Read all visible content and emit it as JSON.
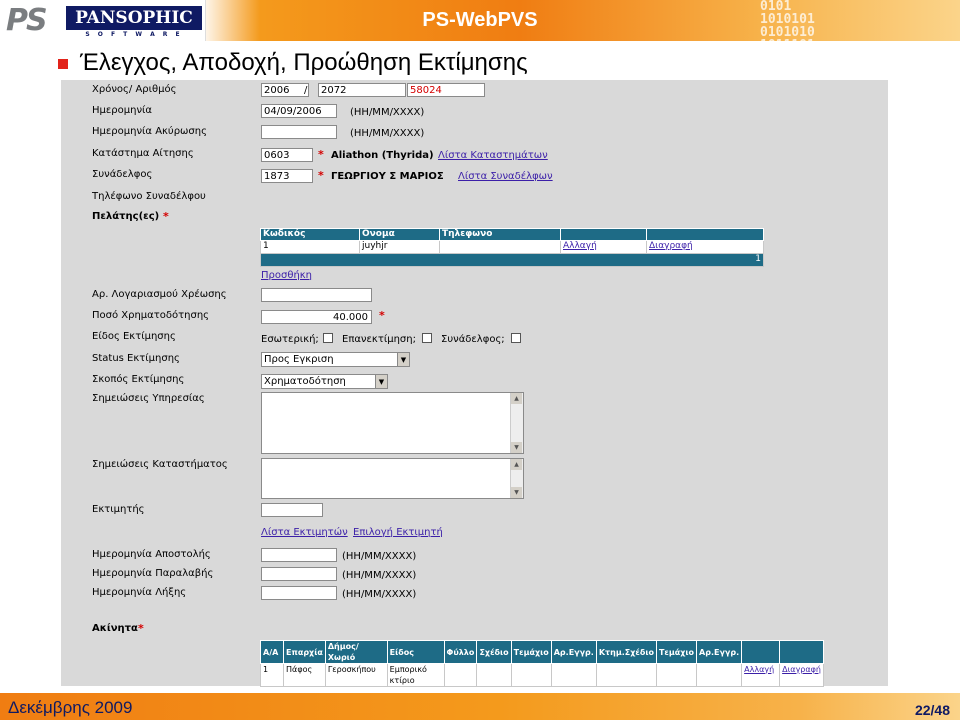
{
  "header": {
    "logo_ps": "PS",
    "logo_name": "PANSOPHIC",
    "logo_sub": "S O F T W A R E",
    "app_title": "PS-WebPVS",
    "binary_deco": "0101\n1010101\n0101010\n1011101"
  },
  "slide_title": "Έλεγχος, Αποδοχή, Προώθηση Εκτίμησης",
  "form": {
    "year_number": {
      "label": "Χρόνος/ Αριθμός",
      "year": "2006",
      "sep": "/",
      "num": "2072",
      "code": "58024"
    },
    "date": {
      "label": "Ημερομηνία",
      "value": "04/09/2006",
      "hint": "(HH/MM/XXXX)"
    },
    "cancel_date": {
      "label": "Ημερομηνία Ακύρωσης",
      "value": "",
      "hint": "(HH/MM/XXXX)"
    },
    "store": {
      "label": "Κατάστημα Αίτησης",
      "code": "0603",
      "star": "*",
      "name": "Aliathon (Thyrida)",
      "link": "Λίστα Καταστημάτων"
    },
    "colleague": {
      "label": "Συνάδελφος",
      "code": "1873",
      "star": "*",
      "name": "ΓΕΩΡΓΙΟΥ Σ ΜΑΡΙΟΣ",
      "link": "Λίστα Συναδέλφων"
    },
    "colleague_phone": {
      "label": "Τηλέφωνο Συναδέλφου"
    },
    "clients": {
      "label": "Πελάτης(ες)",
      "star": "*",
      "columns": [
        "Κωδικός",
        "Ονομα",
        "Τηλεφωνο",
        "",
        ""
      ],
      "rows": [
        [
          "1",
          "juyhjr",
          "",
          "Αλλαγή",
          "Διαγραφή"
        ]
      ],
      "footer": "1",
      "add_link": "Προσθήκη"
    },
    "account": {
      "label": "Αρ. Λογαριασμού Χρέωσης",
      "value": ""
    },
    "amount": {
      "label": "Ποσό Χρηματοδότησης",
      "value": "40.000",
      "star": "*"
    },
    "type": {
      "label": "Είδος Εκτίμησης",
      "opt1": "Εσωτερική;",
      "opt2": "Επανεκτίμηση;",
      "opt3": "Συνάδελφος;"
    },
    "status": {
      "label": "Status Εκτίμησης",
      "value": "Προς Εγκριση"
    },
    "purpose": {
      "label": "Σκοπός Εκτίμησης",
      "value": "Χρηματοδότηση"
    },
    "service_notes": {
      "label": "Σημειώσεις Υπηρεσίας"
    },
    "store_notes": {
      "label": "Σημειώσεις Καταστήματος"
    },
    "valuer": {
      "label": "Εκτιμητής",
      "value": "",
      "link_list": "Λίστα Εκτιμητών",
      "link_select": "Επιλογή Εκτιμητή"
    },
    "send_date": {
      "label": "Ημερομηνία Αποστολής",
      "hint": "(HH/MM/XXXX)"
    },
    "receive_date": {
      "label": "Ημερομηνία Παραλαβής",
      "hint": "(HH/MM/XXXX)"
    },
    "expiry_date": {
      "label": "Ημερομηνία Λήξης",
      "hint": "(HH/MM/XXXX)"
    },
    "properties": {
      "label": "Ακίνητα",
      "star": "*",
      "columns": [
        "Α/Α",
        "Επαρχία",
        "Δήμος/ Χωριό",
        "Είδος",
        "Φύλλο",
        "Σχέδιο",
        "Τεμάχιο",
        "Αρ.Εγγρ.",
        "Κτημ.Σχέδιο",
        "Τεμάχιο",
        "Αρ.Εγγρ.",
        "",
        ""
      ],
      "rows": [
        [
          "1",
          "Πάφος",
          "Γεροσκήπου",
          "Εμπορικό κτίριο",
          "",
          "",
          "",
          "",
          "",
          "",
          "",
          "Αλλαγή",
          "Διαγραφή"
        ]
      ]
    }
  },
  "footer": {
    "date": "Δεκέμβρης 2009",
    "page": "22/48"
  },
  "colors": {
    "accent": "#f07d12",
    "brand_navy": "#0f1a63",
    "table_header": "#1e6b86",
    "required_star": "#d40000",
    "link": "#3b1fa8"
  }
}
